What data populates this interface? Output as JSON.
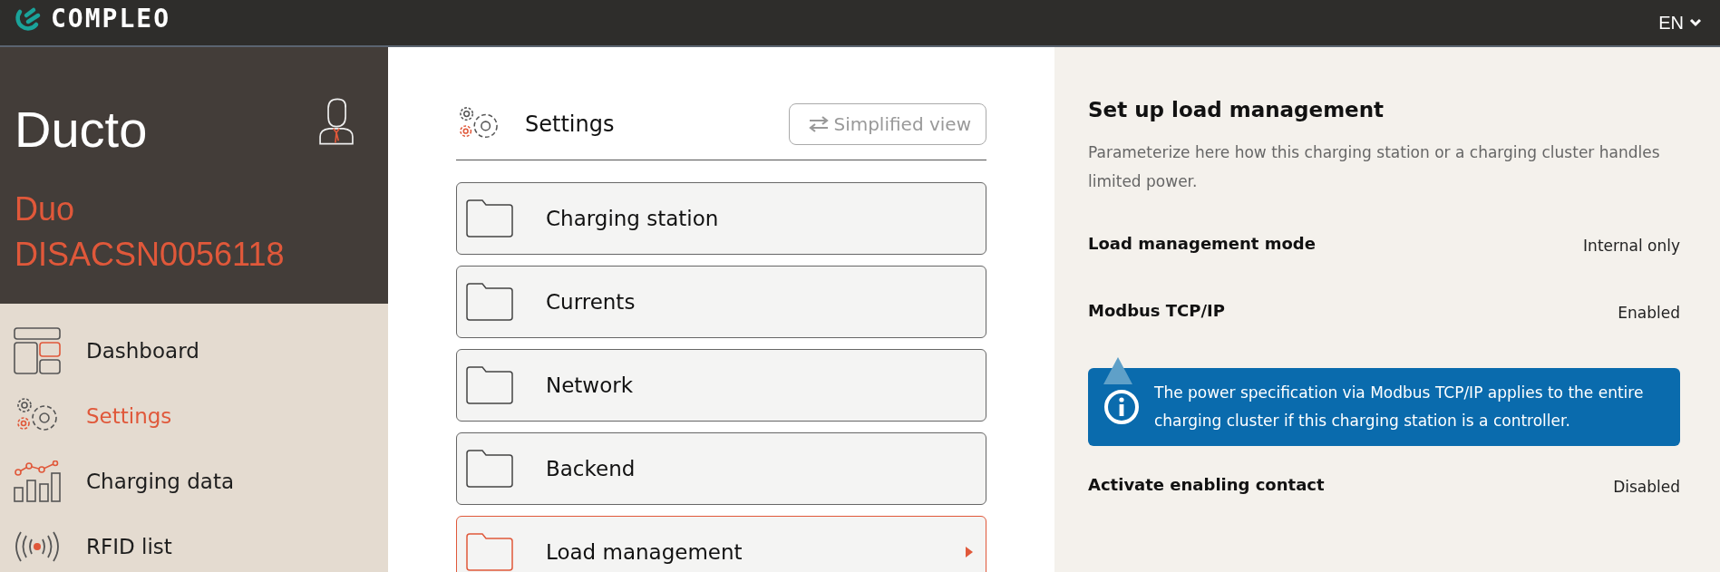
{
  "header": {
    "logo_text": "COMPLEO",
    "language": "EN"
  },
  "station": {
    "name": "Ducto",
    "model": "Duo",
    "serial": "DISACSN0056118"
  },
  "nav": [
    {
      "label": "Dashboard",
      "kind": "dashboard",
      "selected": false
    },
    {
      "label": "Settings",
      "kind": "settings",
      "selected": true
    },
    {
      "label": "Charging data",
      "kind": "chart",
      "selected": false
    },
    {
      "label": "RFID list",
      "kind": "rfid",
      "selected": false
    }
  ],
  "settings": {
    "title": "Settings",
    "view_button": "Simplified view",
    "categories": [
      {
        "label": "Charging station",
        "selected": false
      },
      {
        "label": "Currents",
        "selected": false
      },
      {
        "label": "Network",
        "selected": false
      },
      {
        "label": "Backend",
        "selected": false
      },
      {
        "label": "Load management",
        "selected": true
      }
    ]
  },
  "detail": {
    "title": "Set up load management",
    "description": "Parameterize here how this charging station or a charging cluster handles limited power.",
    "rows": [
      {
        "label": "Load management mode",
        "value": "Internal only"
      },
      {
        "label": "Modbus TCP/IP",
        "value": "Enabled",
        "info": "The power specification via Modbus TCP/IP applies to the entire charging cluster if this charging station is a controller."
      },
      {
        "label": "Activate enabling contact",
        "value": "Disabled"
      }
    ]
  }
}
